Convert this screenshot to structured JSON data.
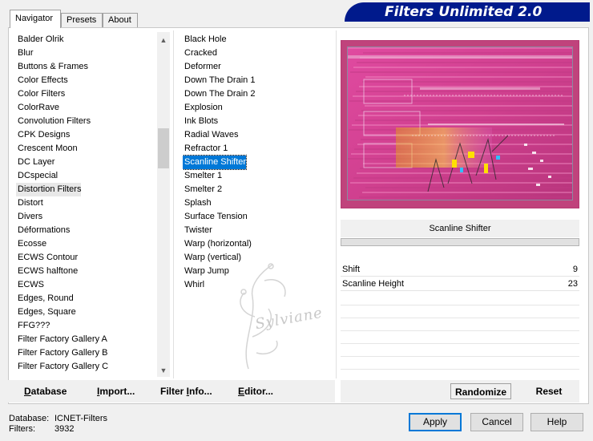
{
  "tabs": [
    {
      "label": "Navigator",
      "active": true
    },
    {
      "label": "Presets",
      "active": false
    },
    {
      "label": "About",
      "active": false
    }
  ],
  "app_title": "Filters Unlimited 2.0",
  "categories": [
    "Balder Olrik",
    "Blur",
    "Buttons & Frames",
    "Color Effects",
    "Color Filters",
    "ColorRave",
    "Convolution Filters",
    "CPK Designs",
    "Crescent Moon",
    "DC Layer",
    "DCspecial",
    "Distortion Filters",
    "Distort",
    "Divers",
    "Déformations",
    "Ecosse",
    "ECWS Contour",
    "ECWS halftone",
    "ECWS",
    "Edges, Round",
    "Edges, Square",
    "FFG???",
    "Filter Factory Gallery A",
    "Filter Factory Gallery B",
    "Filter Factory Gallery C"
  ],
  "selected_category": "Distortion Filters",
  "filters": [
    "Black Hole",
    "Cracked",
    "Deformer",
    "Down The Drain 1",
    "Down The Drain 2",
    "Explosion",
    "Ink Blots",
    "Radial Waves",
    "Refractor 1",
    "Scanline Shifter",
    "Smelter 1",
    "Smelter 2",
    "Splash",
    "Surface Tension",
    "Twister",
    "Warp (horizontal)",
    "Warp (vertical)",
    "Warp Jump",
    "Whirl"
  ],
  "selected_filter": "Scanline Shifter",
  "watermark_text": "Sylviane",
  "params": {
    "header": "Scanline Shifter",
    "rows": [
      {
        "label": "Shift",
        "value": "9"
      },
      {
        "label": "Scanline Height",
        "value": "23"
      }
    ]
  },
  "bottom_links": {
    "database": {
      "first": "D",
      "rest": "atabase"
    },
    "import": {
      "first": "I",
      "rest": "mport..."
    },
    "filter_info": {
      "pre": "Filter ",
      "first": "I",
      "rest": "nfo..."
    },
    "editor": {
      "first": "E",
      "rest": "ditor..."
    }
  },
  "randomize_label": "Randomize",
  "reset_label": "Reset",
  "status": {
    "database_label": "Database:",
    "database_value": "ICNET-Filters",
    "filters_label": "Filters:",
    "filters_value": "3932"
  },
  "buttons": {
    "apply": "Apply",
    "cancel": "Cancel",
    "help": "Help"
  },
  "colors": {
    "banner": "#001a8c",
    "selection": "#0078d7",
    "preview_border": "#c0437c"
  }
}
